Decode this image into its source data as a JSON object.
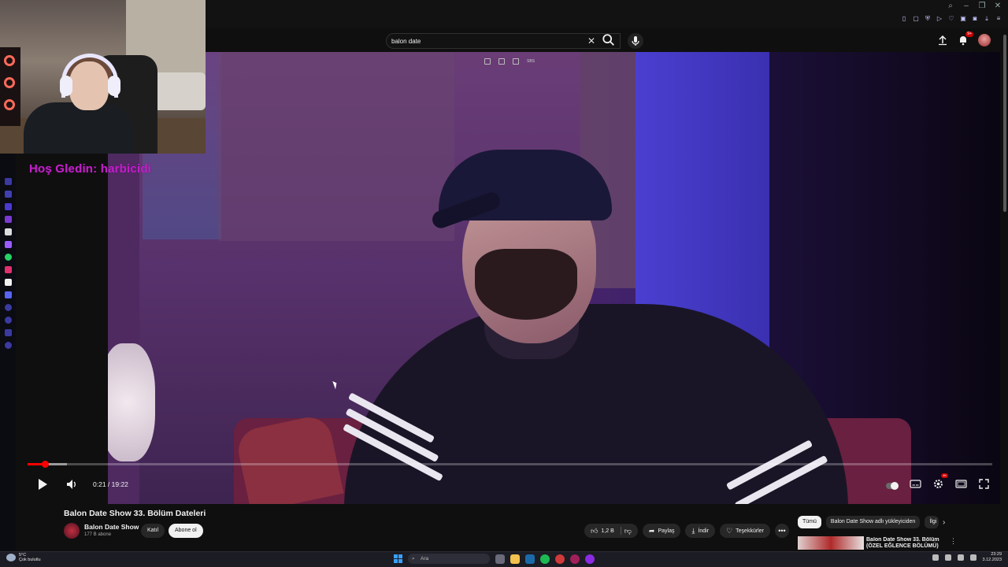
{
  "search": {
    "query": "balon date"
  },
  "overlay": {
    "welcome_text": "Hoş Gledin: harbicidi"
  },
  "header": {
    "notification_count": "9+"
  },
  "player": {
    "mini_controls": [
      "miniplayer",
      "theater",
      "next",
      "SBS"
    ],
    "progress_fraction": 0.018,
    "current_time": "0:21",
    "duration": "19:22",
    "time_display": "0:21 / 19:22",
    "quality_badge": "4K"
  },
  "video": {
    "title": "Balon Date Show 33. Bölüm Dateleri",
    "channel_name": "Balon Date Show",
    "subscribers": "177 B abone",
    "join_label": "Katıl",
    "subscribe_label": "Abone ol",
    "like_count": "1,2 B",
    "share_label": "Paylaş",
    "download_label": "İndir",
    "thanks_label": "Teşekkürler",
    "more_label": "•••"
  },
  "sidebar_recs": {
    "chips": [
      "Tümü",
      "Balon Date Show adlı yükleyiciden",
      "İlgi"
    ],
    "rec_title": "Balon Date Show 33. Bölüm (ÖZEL EĞLENCE BÖLÜMÜ)"
  },
  "taskbar": {
    "weather_temp": "5°C",
    "weather_desc": "Çok bulutlu",
    "search_placeholder": "Ara",
    "time": "23:29",
    "date": "3.12.2023"
  },
  "colors": {
    "accent_red": "#ff0000",
    "overlay_magenta": "#c020c8",
    "background": "#0f0f0f"
  },
  "icons": [
    "search-icon",
    "clear-icon",
    "mic-icon",
    "upload-icon",
    "bell-icon",
    "play-icon",
    "volume-icon",
    "settings-icon",
    "subtitles-icon",
    "theater-icon",
    "fullscreen-icon",
    "like-icon",
    "dislike-icon",
    "share-icon",
    "download-icon",
    "thanks-icon",
    "windows-start-icon"
  ]
}
